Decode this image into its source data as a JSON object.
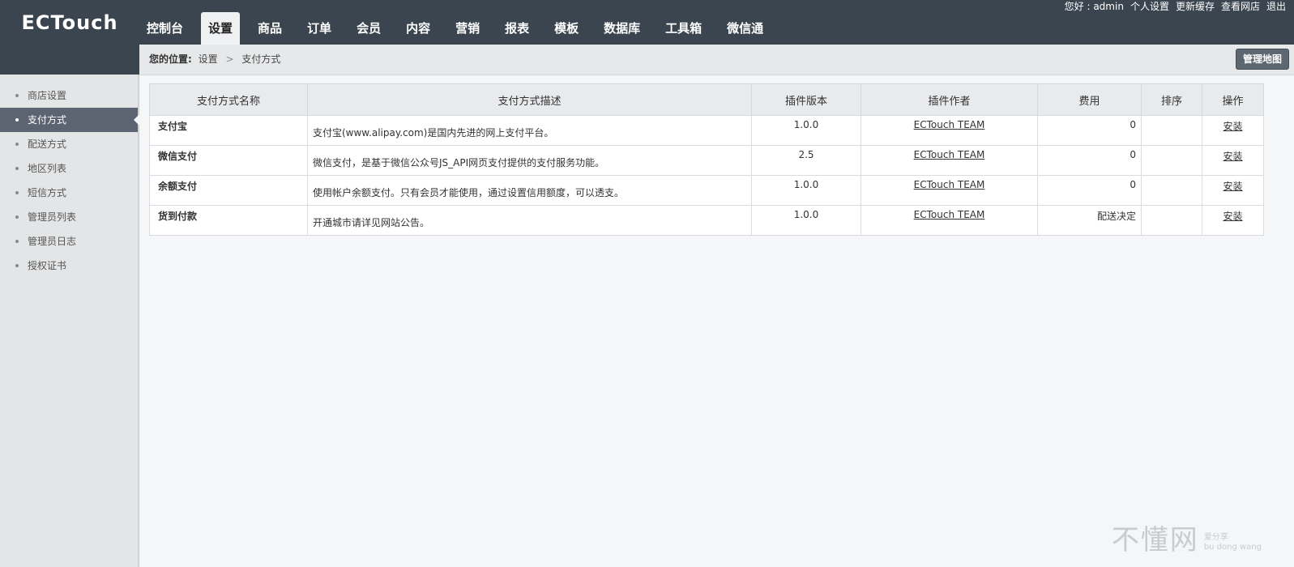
{
  "logo": {
    "text": "ECTouch"
  },
  "nav": [
    {
      "label": "控制台"
    },
    {
      "label": "设置",
      "active": true
    },
    {
      "label": "商品"
    },
    {
      "label": "订单"
    },
    {
      "label": "会员"
    },
    {
      "label": "内容"
    },
    {
      "label": "营销"
    },
    {
      "label": "报表"
    },
    {
      "label": "模板"
    },
    {
      "label": "数据库"
    },
    {
      "label": "工具箱"
    },
    {
      "label": "微信通"
    }
  ],
  "toplinks": {
    "greeting": "您好 : admin",
    "profile": "个人设置",
    "clear_cache": "更新缓存",
    "view_store": "查看网店",
    "logout": "退出"
  },
  "breadcrumb": {
    "label": "您的位置:",
    "parent": "设置",
    "separator": ">",
    "current": "支付方式"
  },
  "map_button": "管理地图",
  "sidebar": [
    {
      "label": "商店设置"
    },
    {
      "label": "支付方式",
      "active": true
    },
    {
      "label": "配送方式"
    },
    {
      "label": "地区列表"
    },
    {
      "label": "短信方式"
    },
    {
      "label": "管理员列表"
    },
    {
      "label": "管理员日志"
    },
    {
      "label": "授权证书"
    }
  ],
  "table": {
    "headers": [
      "支付方式名称",
      "支付方式描述",
      "插件版本",
      "插件作者",
      "费用",
      "排序",
      "操作"
    ],
    "rows": [
      {
        "name": "支付宝",
        "desc": "支付宝(www.alipay.com)是国内先进的网上支付平台。",
        "version": "1.0.0",
        "author": "ECTouch TEAM",
        "fee": "0",
        "order": "",
        "action": "安装"
      },
      {
        "name": "微信支付",
        "desc": "微信支付，是基于微信公众号JS_API网页支付提供的支付服务功能。",
        "version": "2.5",
        "author": "ECTouch TEAM",
        "fee": "0",
        "order": "",
        "action": "安装"
      },
      {
        "name": "余额支付",
        "desc": "使用帐户余额支付。只有会员才能使用，通过设置信用额度，可以透支。",
        "version": "1.0.0",
        "author": "ECTouch TEAM",
        "fee": "0",
        "order": "",
        "action": "安装"
      },
      {
        "name": "货到付款",
        "desc": "开通城市请详见网站公告。",
        "version": "1.0.0",
        "author": "ECTouch TEAM",
        "fee": "配送决定",
        "order": "",
        "action": "安装"
      }
    ]
  },
  "watermark": {
    "big": "不懂网",
    "small_1": "爱分享",
    "small_2": "bu dong wang"
  }
}
